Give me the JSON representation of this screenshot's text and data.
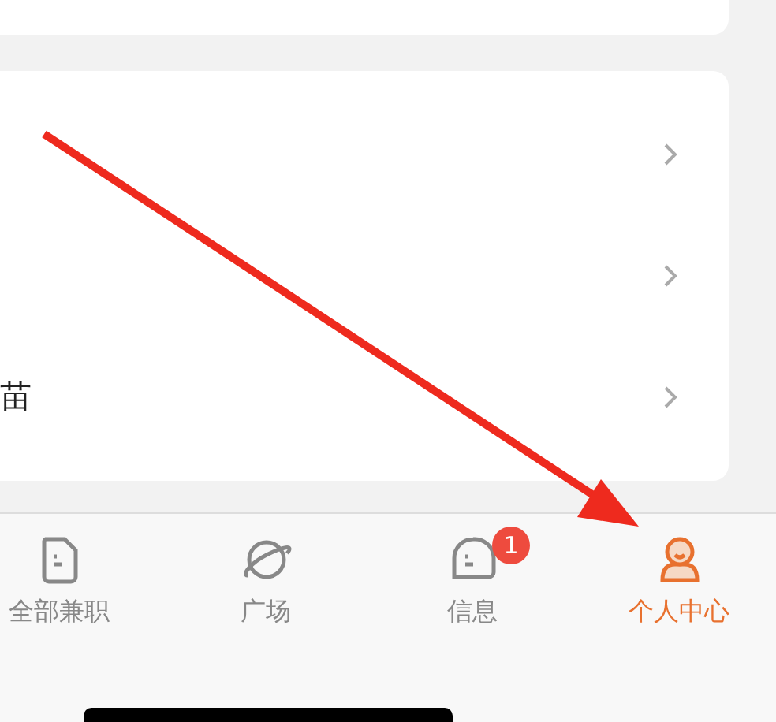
{
  "menu_rows": [
    {},
    {},
    {
      "label": "苗"
    }
  ],
  "tab_bar": [
    {
      "label": "全部兼职",
      "kind": "document",
      "selected": false
    },
    {
      "label": "广场",
      "kind": "planet",
      "selected": false
    },
    {
      "label": "信息",
      "kind": "chat",
      "selected": false,
      "badge": "1"
    },
    {
      "label": "个人中心",
      "kind": "person",
      "selected": true
    }
  ]
}
